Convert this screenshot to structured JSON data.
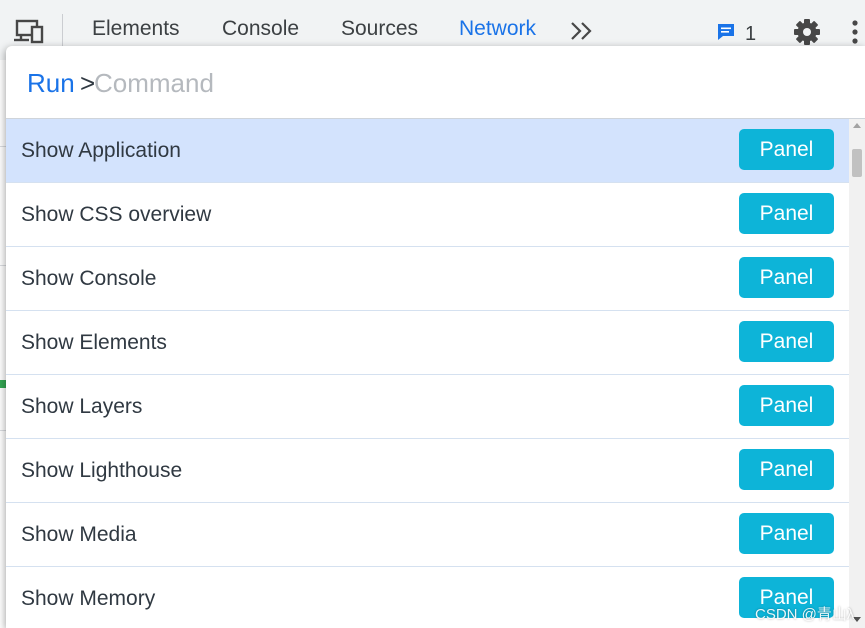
{
  "toolbar": {
    "tabs": [
      {
        "label": "Elements"
      },
      {
        "label": "Console"
      },
      {
        "label": "Sources"
      },
      {
        "label": "Network"
      }
    ],
    "more_tabs_icon": "double-chevron-right-icon",
    "issues": {
      "icon": "message-icon",
      "count": "1"
    },
    "settings_icon": "gear-icon",
    "menu_icon": "vertical-ellipsis-icon",
    "device_toolbar_icon": "device-toggle-icon",
    "active_color": "#1a73e8"
  },
  "command_menu": {
    "run_label": "Run",
    "prefix": ">",
    "input_value": "",
    "placeholder": "Command",
    "items": [
      {
        "label": "Show Application",
        "badge": "Panel",
        "selected": true
      },
      {
        "label": "Show CSS overview",
        "badge": "Panel"
      },
      {
        "label": "Show Console",
        "badge": "Panel"
      },
      {
        "label": "Show Elements",
        "badge": "Panel"
      },
      {
        "label": "Show Layers",
        "badge": "Panel"
      },
      {
        "label": "Show Lighthouse",
        "badge": "Panel"
      },
      {
        "label": "Show Media",
        "badge": "Panel"
      },
      {
        "label": "Show Memory",
        "badge": "Panel"
      }
    ],
    "badge_color": "#0db4d8",
    "selected_color": "#d3e3fd"
  },
  "watermark": "CSDN @青山λ"
}
